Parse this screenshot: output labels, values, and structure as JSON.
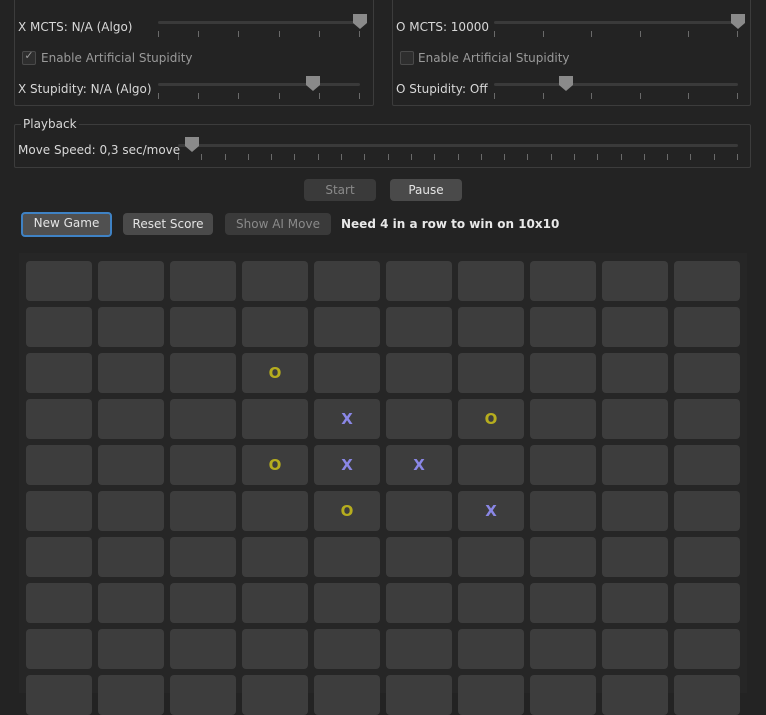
{
  "x_panel": {
    "mcts_label": "X MCTS: N/A (Algo)",
    "mcts_level": 1.0,
    "stupidity_checkbox_label": "Enable Artificial Stupidity",
    "stupidity_checkbox_checked": true,
    "stupidity_label": "X Stupidity: N/A (Algo)",
    "stupidity_level": 0.75
  },
  "o_panel": {
    "mcts_label": "O MCTS: 10000",
    "mcts_level": 1.0,
    "stupidity_checkbox_label": "Enable Artificial Stupidity",
    "stupidity_checkbox_checked": false,
    "stupidity_label": "O Stupidity: Off",
    "stupidity_level": 0.25
  },
  "playback": {
    "title": "Playback",
    "speed_label": "Move Speed: 0,3 sec/move",
    "speed_level": 0.0,
    "start_label": "Start",
    "pause_label": "Pause"
  },
  "toolbar": {
    "new_game_label": "New Game",
    "reset_score_label": "Reset Score",
    "show_ai_move_label": "Show AI Move",
    "status_text": "Need 4 in a row to win on 10x10"
  },
  "board": {
    "size": 10,
    "rows_visible": 10,
    "cells": [
      [
        "",
        "",
        "",
        "",
        "",
        "",
        "",
        "",
        "",
        ""
      ],
      [
        "",
        "",
        "",
        "",
        "",
        "",
        "",
        "",
        "",
        ""
      ],
      [
        "",
        "",
        "",
        "O",
        "",
        "",
        "",
        "",
        "",
        ""
      ],
      [
        "",
        "",
        "",
        "",
        "X",
        "",
        "O",
        "",
        "",
        ""
      ],
      [
        "",
        "",
        "",
        "O",
        "X",
        "X",
        "",
        "",
        "",
        ""
      ],
      [
        "",
        "",
        "",
        "",
        "O",
        "",
        "X",
        "",
        "",
        ""
      ],
      [
        "",
        "",
        "",
        "",
        "",
        "",
        "",
        "",
        "",
        ""
      ],
      [
        "",
        "",
        "",
        "",
        "",
        "",
        "",
        "",
        "",
        ""
      ],
      [
        "",
        "",
        "",
        "",
        "",
        "",
        "",
        "",
        "",
        ""
      ],
      [
        "",
        "",
        "",
        "",
        "",
        "",
        "",
        "",
        "",
        ""
      ]
    ],
    "colors": {
      "x": "#8a87e6",
      "o": "#b6ad1e",
      "cell": "#3d3d3d"
    }
  }
}
